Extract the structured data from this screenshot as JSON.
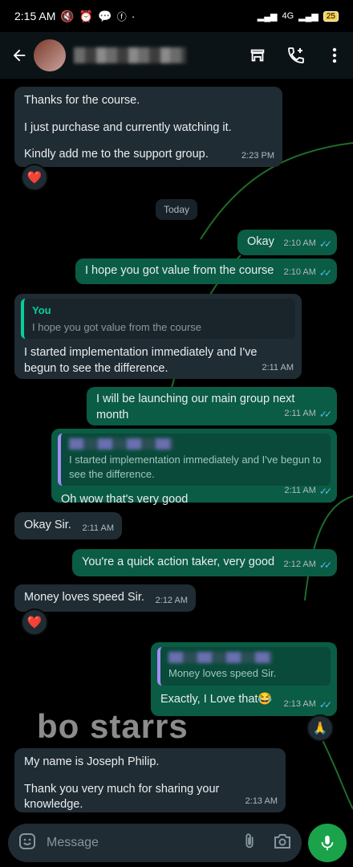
{
  "status_bar": {
    "time": "2:15 AM",
    "network": "4G",
    "battery": "25"
  },
  "header": {
    "contact_name": ""
  },
  "date_chip": "Today",
  "messages": [
    {
      "id": "m1",
      "dir": "in",
      "lines": [
        "Thanks for the course.",
        "I just purchase and currently watching it.",
        "Kindly add me to the support group."
      ],
      "time": "2:23 PM",
      "reaction": "❤️"
    },
    {
      "id": "m2",
      "dir": "out",
      "text": "Okay",
      "time": "2:10 AM"
    },
    {
      "id": "m3",
      "dir": "out",
      "text": "I hope you got value from the course",
      "time": "2:10 AM"
    },
    {
      "id": "m4",
      "dir": "in",
      "quote": {
        "author": "You",
        "text": "I hope you got value from the course"
      },
      "text": "I started implementation immediately and I've begun to see the difference.",
      "time": "2:11 AM"
    },
    {
      "id": "m5",
      "dir": "out",
      "text": "I will be launching our main group next month",
      "time": "2:11 AM"
    },
    {
      "id": "m6",
      "dir": "out",
      "quote": {
        "text": "I started implementation immediately and I've begun to see the difference."
      },
      "text": "Oh wow that's very good",
      "time": "2:11 AM"
    },
    {
      "id": "m7",
      "dir": "in",
      "text": "Okay Sir.",
      "time": "2:11 AM"
    },
    {
      "id": "m8",
      "dir": "out",
      "text": "You're a quick action taker, very good",
      "time": "2:12 AM"
    },
    {
      "id": "m9",
      "dir": "in",
      "text": "Money loves speed Sir.",
      "time": "2:12 AM",
      "reaction": "❤️"
    },
    {
      "id": "m10",
      "dir": "out",
      "quote": {
        "text": "Money loves speed Sir."
      },
      "text": "Exactly, I Love that😂",
      "time": "2:13 AM",
      "reaction": "🙏"
    },
    {
      "id": "m11",
      "dir": "in",
      "lines": [
        "My name is Joseph Philip.",
        "Thank you very much for sharing your knowledge."
      ],
      "time": "2:13 AM"
    }
  ],
  "watermark": "bo starrs",
  "composer": {
    "placeholder": "Message"
  },
  "colors": {
    "incoming": "#202c33",
    "outgoing": "#0b5c45",
    "accent": "#1aa34a",
    "read_ticks": "#53bdeb"
  }
}
